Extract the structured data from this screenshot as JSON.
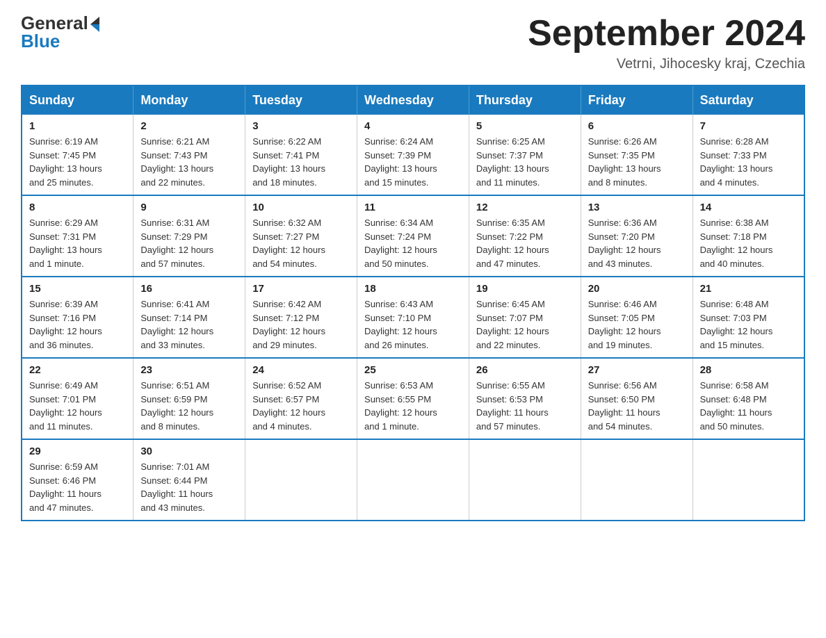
{
  "header": {
    "logo_general": "General",
    "logo_blue": "Blue",
    "month_title": "September 2024",
    "location": "Vetrni, Jihocesky kraj, Czechia"
  },
  "calendar": {
    "days_of_week": [
      "Sunday",
      "Monday",
      "Tuesday",
      "Wednesday",
      "Thursday",
      "Friday",
      "Saturday"
    ],
    "weeks": [
      [
        {
          "day": "1",
          "info": "Sunrise: 6:19 AM\nSunset: 7:45 PM\nDaylight: 13 hours\nand 25 minutes."
        },
        {
          "day": "2",
          "info": "Sunrise: 6:21 AM\nSunset: 7:43 PM\nDaylight: 13 hours\nand 22 minutes."
        },
        {
          "day": "3",
          "info": "Sunrise: 6:22 AM\nSunset: 7:41 PM\nDaylight: 13 hours\nand 18 minutes."
        },
        {
          "day": "4",
          "info": "Sunrise: 6:24 AM\nSunset: 7:39 PM\nDaylight: 13 hours\nand 15 minutes."
        },
        {
          "day": "5",
          "info": "Sunrise: 6:25 AM\nSunset: 7:37 PM\nDaylight: 13 hours\nand 11 minutes."
        },
        {
          "day": "6",
          "info": "Sunrise: 6:26 AM\nSunset: 7:35 PM\nDaylight: 13 hours\nand 8 minutes."
        },
        {
          "day": "7",
          "info": "Sunrise: 6:28 AM\nSunset: 7:33 PM\nDaylight: 13 hours\nand 4 minutes."
        }
      ],
      [
        {
          "day": "8",
          "info": "Sunrise: 6:29 AM\nSunset: 7:31 PM\nDaylight: 13 hours\nand 1 minute."
        },
        {
          "day": "9",
          "info": "Sunrise: 6:31 AM\nSunset: 7:29 PM\nDaylight: 12 hours\nand 57 minutes."
        },
        {
          "day": "10",
          "info": "Sunrise: 6:32 AM\nSunset: 7:27 PM\nDaylight: 12 hours\nand 54 minutes."
        },
        {
          "day": "11",
          "info": "Sunrise: 6:34 AM\nSunset: 7:24 PM\nDaylight: 12 hours\nand 50 minutes."
        },
        {
          "day": "12",
          "info": "Sunrise: 6:35 AM\nSunset: 7:22 PM\nDaylight: 12 hours\nand 47 minutes."
        },
        {
          "day": "13",
          "info": "Sunrise: 6:36 AM\nSunset: 7:20 PM\nDaylight: 12 hours\nand 43 minutes."
        },
        {
          "day": "14",
          "info": "Sunrise: 6:38 AM\nSunset: 7:18 PM\nDaylight: 12 hours\nand 40 minutes."
        }
      ],
      [
        {
          "day": "15",
          "info": "Sunrise: 6:39 AM\nSunset: 7:16 PM\nDaylight: 12 hours\nand 36 minutes."
        },
        {
          "day": "16",
          "info": "Sunrise: 6:41 AM\nSunset: 7:14 PM\nDaylight: 12 hours\nand 33 minutes."
        },
        {
          "day": "17",
          "info": "Sunrise: 6:42 AM\nSunset: 7:12 PM\nDaylight: 12 hours\nand 29 minutes."
        },
        {
          "day": "18",
          "info": "Sunrise: 6:43 AM\nSunset: 7:10 PM\nDaylight: 12 hours\nand 26 minutes."
        },
        {
          "day": "19",
          "info": "Sunrise: 6:45 AM\nSunset: 7:07 PM\nDaylight: 12 hours\nand 22 minutes."
        },
        {
          "day": "20",
          "info": "Sunrise: 6:46 AM\nSunset: 7:05 PM\nDaylight: 12 hours\nand 19 minutes."
        },
        {
          "day": "21",
          "info": "Sunrise: 6:48 AM\nSunset: 7:03 PM\nDaylight: 12 hours\nand 15 minutes."
        }
      ],
      [
        {
          "day": "22",
          "info": "Sunrise: 6:49 AM\nSunset: 7:01 PM\nDaylight: 12 hours\nand 11 minutes."
        },
        {
          "day": "23",
          "info": "Sunrise: 6:51 AM\nSunset: 6:59 PM\nDaylight: 12 hours\nand 8 minutes."
        },
        {
          "day": "24",
          "info": "Sunrise: 6:52 AM\nSunset: 6:57 PM\nDaylight: 12 hours\nand 4 minutes."
        },
        {
          "day": "25",
          "info": "Sunrise: 6:53 AM\nSunset: 6:55 PM\nDaylight: 12 hours\nand 1 minute."
        },
        {
          "day": "26",
          "info": "Sunrise: 6:55 AM\nSunset: 6:53 PM\nDaylight: 11 hours\nand 57 minutes."
        },
        {
          "day": "27",
          "info": "Sunrise: 6:56 AM\nSunset: 6:50 PM\nDaylight: 11 hours\nand 54 minutes."
        },
        {
          "day": "28",
          "info": "Sunrise: 6:58 AM\nSunset: 6:48 PM\nDaylight: 11 hours\nand 50 minutes."
        }
      ],
      [
        {
          "day": "29",
          "info": "Sunrise: 6:59 AM\nSunset: 6:46 PM\nDaylight: 11 hours\nand 47 minutes."
        },
        {
          "day": "30",
          "info": "Sunrise: 7:01 AM\nSunset: 6:44 PM\nDaylight: 11 hours\nand 43 minutes."
        },
        {
          "day": "",
          "info": ""
        },
        {
          "day": "",
          "info": ""
        },
        {
          "day": "",
          "info": ""
        },
        {
          "day": "",
          "info": ""
        },
        {
          "day": "",
          "info": ""
        }
      ]
    ]
  }
}
